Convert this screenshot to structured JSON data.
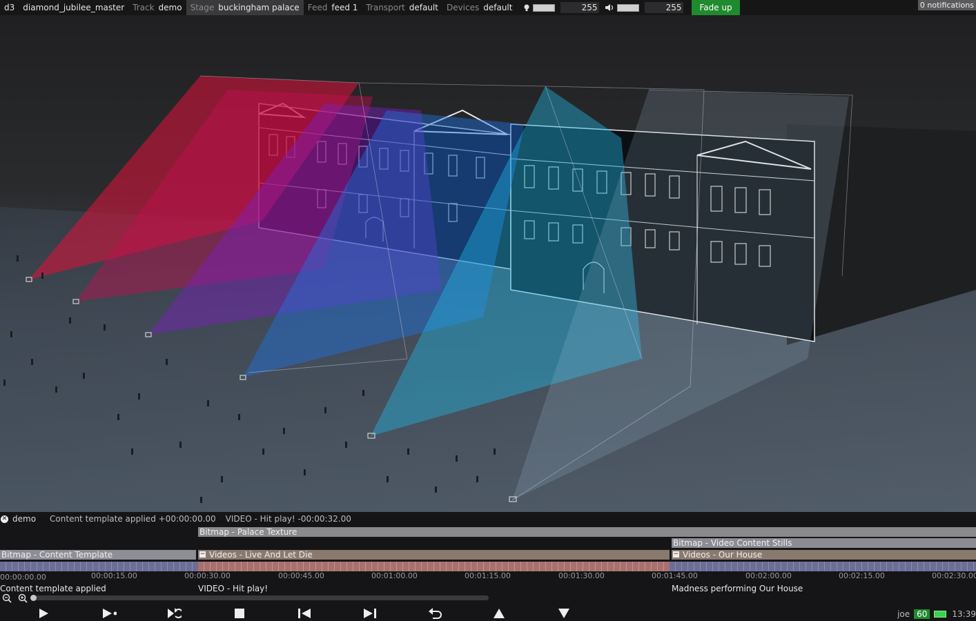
{
  "topbar": {
    "app": "d3",
    "project": "diamond_jubilee_master",
    "track_label": "Track",
    "track_value": "demo",
    "stage_label": "Stage",
    "stage_value": "buckingham palace",
    "feed_label": "Feed",
    "feed_value": "feed 1",
    "transport_label": "Transport",
    "transport_value": "default",
    "devices_label": "Devices",
    "devices_value": "default",
    "brightness_value": "255",
    "volume_value": "255",
    "fade_button": "Fade up",
    "notifications": "0 notifications"
  },
  "timeline": {
    "track_name": "demo",
    "status_template": "Content template applied +00:00:00.00",
    "status_video": "VIDEO - Hit play! -00:00:32.00",
    "layers": {
      "bitmap_palace": "Bitmap - Palace Texture",
      "bitmap_stills": "Bitmap - Video Content Stills",
      "bitmap_template": "Bitmap - Content Template",
      "videos_live": "Videos - Live And Let Die",
      "videos_house": "Videos - Our House"
    },
    "ticks": [
      "00:00:00.00",
      "00:00:15.00",
      "00:00:30.00",
      "00:00:45.00",
      "00:01:00.00",
      "00:01:15.00",
      "00:01:30.00",
      "00:01:45.00",
      "00:02:00.00",
      "00:02:15.00",
      "00:02:30.00"
    ],
    "notes": {
      "n1": "Content template applied",
      "n2": "VIDEO - Hit play!",
      "n3": "Madness performing Our House"
    }
  },
  "status": {
    "user": "joe",
    "fps": "60",
    "clock": "13:39"
  },
  "colors": {
    "accent_green": "#1f8a2e",
    "beam_red": "#e0103a",
    "beam_blue": "#2070e0",
    "beam_cyan": "#20b8e8"
  }
}
